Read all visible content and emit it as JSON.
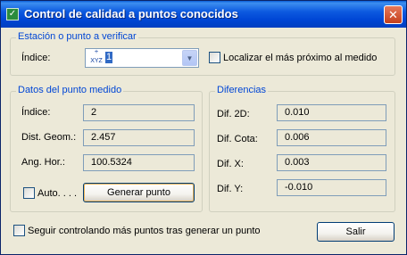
{
  "window": {
    "title": "Control de calidad a puntos conocidos",
    "close_label": "✕"
  },
  "station": {
    "legend": "Estación o punto a verificar",
    "index_label": "Índice:",
    "index_icon_text": "XYZ",
    "index_value": "1",
    "nearest_label": "Localizar el más próximo al medido",
    "nearest_checked": false
  },
  "measured": {
    "legend": "Datos del punto medido",
    "index_label": "Índice:",
    "index_value": "2",
    "dist_label": "Dist. Geom.:",
    "dist_value": "2.457",
    "ang_label": "Ang. Hor.:",
    "ang_value": "100.5324",
    "auto_label": "Auto. . . .",
    "auto_checked": false,
    "generate_label": "Generar punto"
  },
  "differences": {
    "legend": "Diferencias",
    "d2d_label": "Dif. 2D:",
    "d2d_value": "0.010",
    "cota_label": "Dif. Cota:",
    "cota_value": "0.006",
    "x_label": "Dif. X:",
    "x_value": "0.003",
    "y_label": "Dif. Y:",
    "y_value": "-0.010"
  },
  "footer": {
    "continue_label": "Seguir controlando más puntos tras generar un punto",
    "continue_checked": false,
    "exit_label": "Salir"
  },
  "colors": {
    "title_bar": "#0046d5",
    "group_legend": "#0046d5",
    "dialog_bg": "#ece9d8",
    "selection": "#316ac5"
  }
}
